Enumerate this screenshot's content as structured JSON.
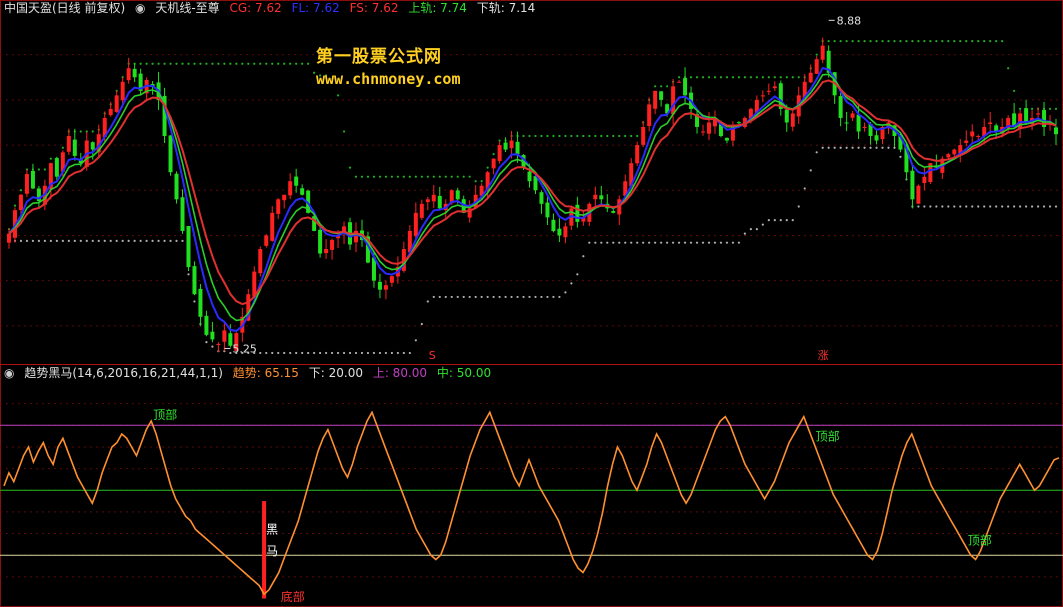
{
  "upper_header": {
    "stock_name": "中国天盈(日线 前复权)",
    "indicator": "天机线-至尊",
    "cg_label": "CG: 7.62",
    "fl_label": "FL: 7.62",
    "fs_label": "FS: 7.62",
    "upper_label": "上轨: 7.74",
    "lower_label": "下轨: 7.14"
  },
  "lower_header": {
    "indicator": "趋势黑马(14,6,2016,16,21,44,1,1)",
    "trend_label": "趋势: 65.15",
    "down_label": "下: 20.00",
    "up_label": "上: 80.00",
    "mid_label": "中: 50.00"
  },
  "watermark": {
    "line1": "第一股票公式网",
    "line2": "www.chnmoney.com"
  },
  "colors": {
    "up": "#ff2020",
    "down": "#20e020",
    "cg": "#e03030",
    "fl": "#2ad02a",
    "fs": "#2a2aff",
    "upper_band": "#20b020",
    "lower_band": "#b0b0b0",
    "trend": "#ff9030",
    "line_up": "#c040c0",
    "line_mid": "#20c020",
    "line_down": "#d8d8a0"
  },
  "chart_data": [
    {
      "type": "candlestick",
      "ylim": [
        5.1,
        8.95
      ],
      "annotations": [
        {
          "text": "8.88",
          "value": 8.88,
          "index": 137
        },
        {
          "text": "5.25",
          "value": 5.25,
          "index": 36
        },
        {
          "text": "S",
          "index": 71
        },
        {
          "text": "涨",
          "index": 136
        }
      ],
      "close": [
        6.52,
        6.78,
        6.95,
        7.18,
        7.02,
        6.88,
        7.05,
        7.3,
        7.15,
        7.42,
        7.6,
        7.38,
        7.3,
        7.55,
        7.45,
        7.62,
        7.8,
        7.9,
        8.05,
        8.2,
        8.35,
        8.25,
        8.1,
        8.22,
        8.15,
        8.0,
        7.6,
        7.2,
        6.9,
        6.55,
        6.15,
        5.85,
        5.6,
        5.4,
        5.35,
        5.3,
        5.45,
        5.28,
        5.42,
        5.6,
        5.85,
        6.1,
        6.35,
        6.5,
        6.75,
        6.9,
        6.95,
        7.1,
        7.05,
        6.95,
        6.75,
        6.55,
        6.3,
        6.35,
        6.45,
        6.5,
        6.6,
        6.4,
        6.55,
        6.45,
        6.2,
        6.0,
        5.9,
        5.95,
        6.05,
        6.15,
        6.35,
        6.55,
        6.75,
        6.85,
        6.9,
        6.95,
        6.8,
        6.85,
        7.0,
        6.9,
        6.75,
        6.8,
        6.95,
        7.05,
        7.2,
        7.35,
        7.5,
        7.45,
        7.55,
        7.4,
        7.25,
        7.1,
        7.0,
        6.85,
        6.7,
        6.55,
        6.5,
        6.6,
        6.8,
        6.65,
        6.7,
        6.85,
        6.95,
        6.9,
        6.8,
        6.75,
        6.9,
        7.1,
        7.3,
        7.5,
        7.7,
        7.95,
        8.1,
        8.0,
        7.85,
        8.15,
        8.2,
        8.05,
        7.9,
        7.7,
        7.65,
        7.75,
        7.8,
        7.6,
        7.55,
        7.7,
        7.75,
        7.8,
        7.9,
        8.0,
        8.05,
        8.1,
        8.15,
        7.9,
        7.75,
        7.85,
        8.05,
        8.2,
        8.3,
        8.45,
        8.6,
        8.3,
        8.05,
        7.8,
        7.75,
        7.85,
        7.65,
        7.7,
        7.6,
        7.55,
        7.7,
        7.75,
        7.6,
        7.45,
        7.2,
        6.9,
        7.05,
        7.15,
        7.3,
        7.25,
        7.35,
        7.4,
        7.45,
        7.5,
        7.55,
        7.65,
        7.6,
        7.7,
        7.75,
        7.65,
        7.7,
        7.8,
        7.7,
        7.85,
        7.75,
        7.8,
        7.85,
        7.7,
        7.75,
        7.62
      ]
    },
    {
      "type": "line",
      "ylim": [
        -3,
        100
      ],
      "reference_lines": {
        "down": 20,
        "mid": 50,
        "up": 80
      },
      "annotations": [
        {
          "text": "顶部",
          "index": 30
        },
        {
          "text": "顶部",
          "index": 165
        },
        {
          "text": "顶部",
          "index": 196
        },
        {
          "text": "黑",
          "index": 53
        },
        {
          "text": "马",
          "index": 53
        },
        {
          "text": "底部",
          "index": 56
        }
      ],
      "signal_bar": {
        "index": 53,
        "from": 0,
        "to": 45
      },
      "trend": [
        52,
        58,
        54,
        60,
        66,
        70,
        63,
        68,
        72,
        66,
        62,
        70,
        74,
        68,
        62,
        56,
        52,
        48,
        44,
        50,
        58,
        64,
        70,
        72,
        76,
        74,
        70,
        66,
        72,
        78,
        82,
        76,
        68,
        60,
        52,
        46,
        42,
        38,
        36,
        32,
        30,
        28,
        26,
        24,
        22,
        20,
        18,
        16,
        14,
        12,
        10,
        8,
        6,
        2,
        4,
        8,
        12,
        18,
        24,
        30,
        36,
        44,
        52,
        60,
        68,
        74,
        78,
        72,
        66,
        60,
        56,
        62,
        70,
        76,
        82,
        86,
        80,
        74,
        68,
        62,
        56,
        50,
        44,
        38,
        32,
        28,
        24,
        20,
        18,
        20,
        26,
        34,
        42,
        50,
        58,
        66,
        72,
        78,
        82,
        86,
        80,
        74,
        68,
        62,
        56,
        52,
        58,
        64,
        58,
        52,
        48,
        44,
        40,
        36,
        30,
        24,
        18,
        14,
        12,
        16,
        22,
        30,
        40,
        52,
        62,
        70,
        66,
        60,
        54,
        50,
        56,
        62,
        70,
        76,
        72,
        66,
        60,
        54,
        48,
        44,
        48,
        54,
        60,
        66,
        72,
        78,
        82,
        84,
        80,
        74,
        68,
        62,
        58,
        54,
        50,
        46,
        50,
        54,
        60,
        66,
        72,
        76,
        80,
        84,
        78,
        72,
        66,
        60,
        54,
        48,
        44,
        40,
        36,
        32,
        28,
        24,
        20,
        18,
        22,
        30,
        40,
        50,
        58,
        66,
        72,
        76,
        70,
        64,
        58,
        52,
        48,
        44,
        40,
        36,
        32,
        28,
        24,
        20,
        18,
        22,
        28,
        34,
        40,
        46,
        50,
        54,
        58,
        62,
        58,
        54,
        50,
        52,
        56,
        60,
        64,
        65
      ]
    }
  ]
}
